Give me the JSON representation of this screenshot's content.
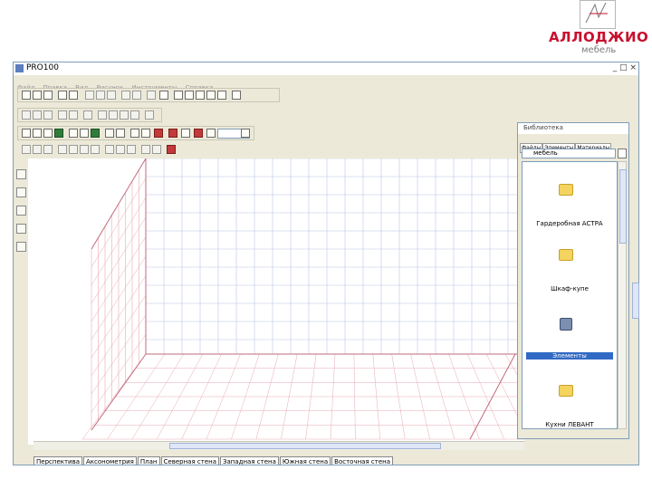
{
  "logo": {
    "brand": "АЛЛОДЖИО",
    "tagline": "мебель"
  },
  "window": {
    "title": "PRO100",
    "controls": "_ □ ×",
    "menu": [
      "Файл",
      "Правка",
      "Вид",
      "Рисунок",
      "Инструменты",
      "Справка"
    ]
  },
  "library": {
    "title": "Библиотека",
    "tabs": [
      "Файлы",
      "Элементы",
      "Материалы"
    ],
    "path": "мебель",
    "items": [
      {
        "label": "Гардеробная АСТРА",
        "icon": "folder-icon",
        "selected": false
      },
      {
        "label": "Шкаф-купе",
        "icon": "folder-icon",
        "selected": false
      },
      {
        "label": "Элементы",
        "icon": "disk-icon",
        "selected": true
      },
      {
        "label": "Кухни ЛЕВАНТ",
        "icon": "folder-icon",
        "selected": false
      }
    ]
  },
  "view_tabs": [
    "Перспектива",
    "Аксонометрия",
    "План",
    "Северная стена",
    "Западная стена",
    "Южная стена",
    "Восточная стена"
  ],
  "colors": {
    "grid_blue": "#b9c6e6",
    "grid_red": "#e8a9b5",
    "brand_red": "#c8102e"
  }
}
